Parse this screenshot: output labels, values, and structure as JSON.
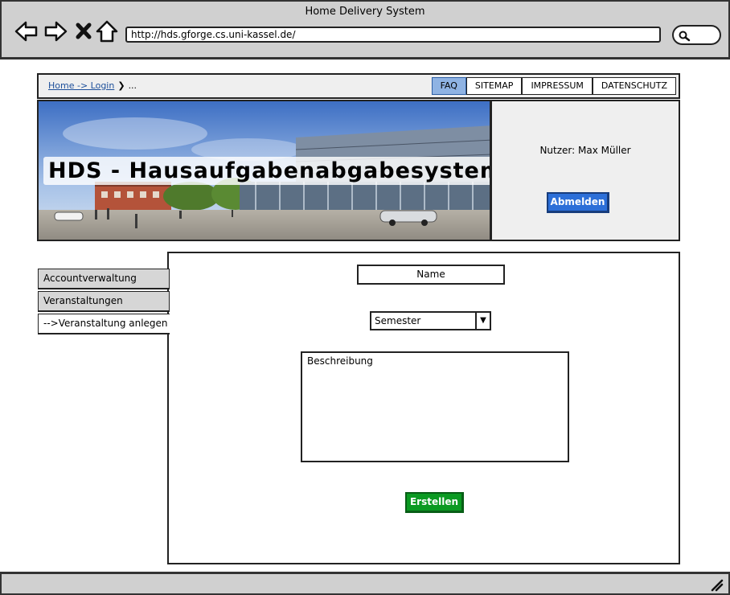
{
  "window": {
    "title": "Home Delivery System"
  },
  "browser": {
    "url": "http://hds.gforge.cs.uni-kassel.de/",
    "icons": [
      "back-arrow-icon",
      "forward-arrow-icon",
      "close-icon",
      "home-icon",
      "search-icon"
    ]
  },
  "breadcrumb": {
    "link": "Home -> Login",
    "separator": "❯",
    "rest": "..."
  },
  "topnav": {
    "tabs": [
      "FAQ",
      "SITEMAP",
      "IMPRESSUM",
      "DATENSCHUTZ"
    ],
    "active": "FAQ"
  },
  "header": {
    "title": "HDS - Hausaufgabenabgabesystem"
  },
  "user": {
    "label": "Nutzer: Max Müller",
    "logout_label": "Abmelden"
  },
  "sidebar": {
    "items": [
      {
        "label": "Accountverwaltung"
      },
      {
        "label": "Veranstaltungen"
      },
      {
        "label": "-->Veranstaltung anlegen"
      }
    ]
  },
  "form": {
    "name_placeholder": "Name",
    "semester_value": "Semester",
    "description_placeholder": "Beschreibung",
    "submit_label": "Erstellen"
  },
  "colors": {
    "chrome": "#d0d0d0",
    "active_tab": "#8fb3e3",
    "logout_button": "#2c6fd8",
    "submit_button": "#0b9a22",
    "link": "#1d4f9a"
  }
}
